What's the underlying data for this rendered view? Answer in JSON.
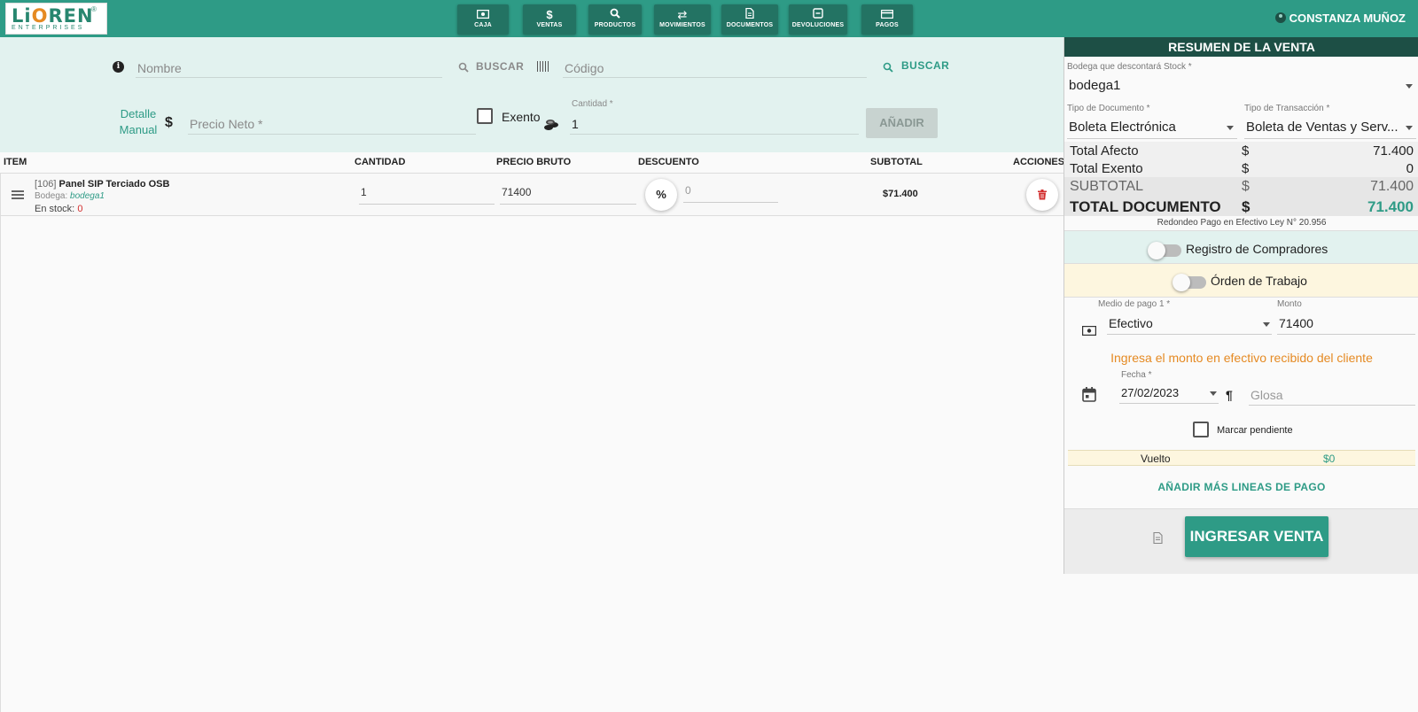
{
  "logo": {
    "brand_pre": "Li",
    "brand_o": "O",
    "brand_post": "REN",
    "registered": "®",
    "tagline": "ENTERPRISES"
  },
  "nav": [
    {
      "label": "CAJA",
      "icon": "cash-icon"
    },
    {
      "label": "VENTAS",
      "icon": "dollar-icon"
    },
    {
      "label": "PRODUCTOS",
      "icon": "search-icon"
    },
    {
      "label": "MOVIMIENTOS",
      "icon": "swap-icon"
    },
    {
      "label": "DOCUMENTOS",
      "icon": "document-icon"
    },
    {
      "label": "DEVOLUCIONES",
      "icon": "return-icon"
    },
    {
      "label": "PAGOS",
      "icon": "card-icon"
    }
  ],
  "user": {
    "name": "CONSTANZA MUÑOZ"
  },
  "search": {
    "nombre_placeholder": "Nombre",
    "buscar_label_1": "BUSCAR",
    "codigo_placeholder": "Código",
    "buscar_label_2": "BUSCAR",
    "detalle_line1": "Detalle",
    "detalle_line2": "Manual",
    "currency": "$",
    "precio_placeholder": "Precio Neto *",
    "exento_label": "Exento",
    "cantidad_label": "Cantidad *",
    "cantidad_value": "1",
    "anadir_label": "AÑADIR"
  },
  "table": {
    "headers": {
      "item": "ITEM",
      "cantidad": "CANTIDAD",
      "precio": "PRECIO BRUTO",
      "descuento": "DESCUENTO",
      "subtotal": "SUBTOTAL",
      "acciones": "ACCIONES"
    },
    "rows": [
      {
        "code": "[106]",
        "name": "Panel SIP Terciado OSB",
        "bodega_label": "Bodega:",
        "bodega": "bodega1",
        "stock_label": "En stock:",
        "stock": "0",
        "cantidad": "1",
        "precio": "71400",
        "percent": "%",
        "descuento": "0",
        "subtotal": "$71.400"
      }
    ]
  },
  "summary": {
    "title": "RESUMEN DE LA VENTA",
    "bodega_label": "Bodega que descontará Stock *",
    "bodega_value": "bodega1",
    "tipo_doc_label": "Tipo de Documento *",
    "tipo_doc_value": "Boleta Electrónica",
    "tipo_tx_label": "Tipo de Transacción *",
    "tipo_tx_value": "Boleta de Ventas y Serv...",
    "totals": [
      {
        "label": "Total Afecto",
        "cur": "$",
        "value": "71.400"
      },
      {
        "label": "Total Exento",
        "cur": "$",
        "value": "0"
      },
      {
        "label": "SUBTOTAL",
        "cur": "$",
        "value": "71.400"
      },
      {
        "label": "TOTAL DOCUMENTO",
        "cur": "$",
        "value": "71.400"
      }
    ],
    "redondeo": "Redondeo Pago en Efectivo Ley N° 20.956",
    "registro_compradores": "Registro de Compradores",
    "orden_trabajo": "Órden de Trabajo",
    "medio_label": "Medio de pago 1 *",
    "medio_value": "Efectivo",
    "monto_label": "Monto",
    "monto_value": "71400",
    "hint": "Ingresa el monto en efectivo recibido del cliente",
    "fecha_label": "Fecha *",
    "fecha_value": "27/02/2023",
    "glosa_placeholder": "Glosa",
    "marcar_label": "Marcar pendiente",
    "vuelto_label": "Vuelto",
    "vuelto_value": "$0",
    "mas_lineas": "AÑADIR MÁS LINEAS DE PAGO",
    "ingresar": "INGRESAR VENTA"
  },
  "colors": {
    "primary": "#2e9b86",
    "dark": "#1d4f45",
    "accent_orange": "#e58a23",
    "danger": "#d32f2f"
  }
}
